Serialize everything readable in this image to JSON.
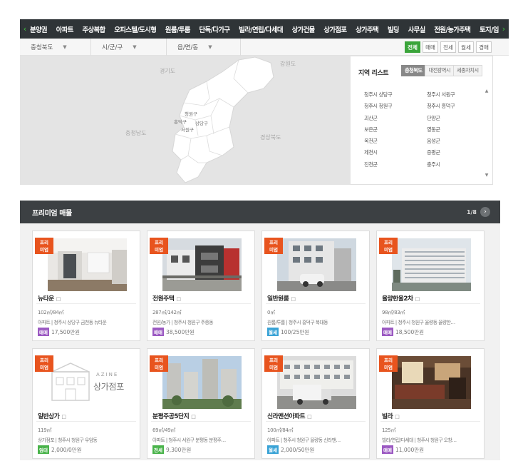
{
  "nav": {
    "categories": [
      "분양권",
      "아파트",
      "주상복합",
      "오피스텔/도시형",
      "원룸/투룸",
      "단독/다가구",
      "빌라/연립/다세대",
      "상가건물",
      "상가점포",
      "상가주택",
      "빌딩",
      "사무실",
      "전원/농가주택",
      "토지/임"
    ],
    "prev_arrow": "‹",
    "next_arrow": "›"
  },
  "filters": {
    "province": "충청북도",
    "city": "시/군/구",
    "town": "읍/면/동",
    "caret": "▼",
    "deal_types": [
      "전체",
      "매매",
      "전세",
      "월세",
      "경매"
    ]
  },
  "map": {
    "labels": {
      "gyeonggi": "경기도",
      "gangwon": "강원도",
      "chungnam": "충청남도",
      "gyeongbuk": "경상북도",
      "cheongwon": "청원구",
      "heungdeok": "흥덕구",
      "sangdang": "상당구",
      "seowon": "서원구"
    }
  },
  "region_panel": {
    "title": "지역 리스트",
    "tabs": [
      "충청북도",
      "대전광역시",
      "세종자치시"
    ],
    "regions": [
      "청주시 상당구",
      "청주시 서원구",
      "청주시 청원구",
      "청주시 흥덕구",
      "괴산군",
      "단양군",
      "보은군",
      "영동군",
      "옥천군",
      "음성군",
      "제천시",
      "증평군",
      "진천군",
      "충주시"
    ],
    "scroll_up": "▲",
    "scroll_down": "▼"
  },
  "premium": {
    "title": "프리미엄 매물",
    "pager": "1/8",
    "next_icon": "›",
    "badge_line1": "프리",
    "badge_line2": "미엄",
    "flag_icon": "□",
    "listings": [
      {
        "name": "뉴타운",
        "area": "102㎡/84㎡",
        "desc": "아파트 | 청주시 상당구 금천동 뉴타운",
        "deal": "매매",
        "deal_color": "#9b59c2",
        "price": "17,500만원",
        "photo": "interior-white"
      },
      {
        "name": "전원주택",
        "area": "287㎡/142㎡",
        "desc": "전원/농가 | 청주시 청원구 주중동",
        "deal": "매매",
        "deal_color": "#9b59c2",
        "price": "38,500만원",
        "photo": "modern-house"
      },
      {
        "name": "일반원룸",
        "area": "0㎡",
        "desc": "원룸/투룸 | 청주시 흥덕구 복대동",
        "deal": "월세",
        "deal_color": "#3aa3d6",
        "price": "100/25만원",
        "photo": "oneroom-building"
      },
      {
        "name": "율량한울2차",
        "area": "98㎡/83㎡",
        "desc": "아파트 | 청주시 청원구 율량동 율량한…",
        "deal": "매매",
        "deal_color": "#9b59c2",
        "price": "18,500만원",
        "photo": "apartment-block"
      },
      {
        "name": "일반상가",
        "area": "119㎡",
        "desc": "상가점포 | 청주시 청원구 우암동",
        "deal": "임대",
        "deal_color": "#49b34a",
        "price": "2,000/0만원",
        "photo": "shop-logo",
        "logo_en": "AZINE",
        "logo_ko": "상가점포"
      },
      {
        "name": "분평주공5단지",
        "area": "69㎡/49㎡",
        "desc": "아파트 | 청주시 서원구 분평동 분평주…",
        "deal": "전세",
        "deal_color": "#49b34a",
        "price": "9,300만원",
        "photo": "apartment-towers"
      },
      {
        "name": "신라맨션아파트",
        "area": "100㎡/84㎡",
        "desc": "아파트 | 청주시 청원구 율량동 신라맨…",
        "deal": "월세",
        "deal_color": "#3aa3d6",
        "price": "2,000/50만원",
        "photo": "mansion-truck"
      },
      {
        "name": "빌라",
        "area": "125㎡",
        "desc": "빌라/연립/다세대 | 청주시 청원구 오창…",
        "deal": "매매",
        "deal_color": "#9b59c2",
        "price": "11,000만원",
        "photo": "villa-interior"
      }
    ]
  }
}
